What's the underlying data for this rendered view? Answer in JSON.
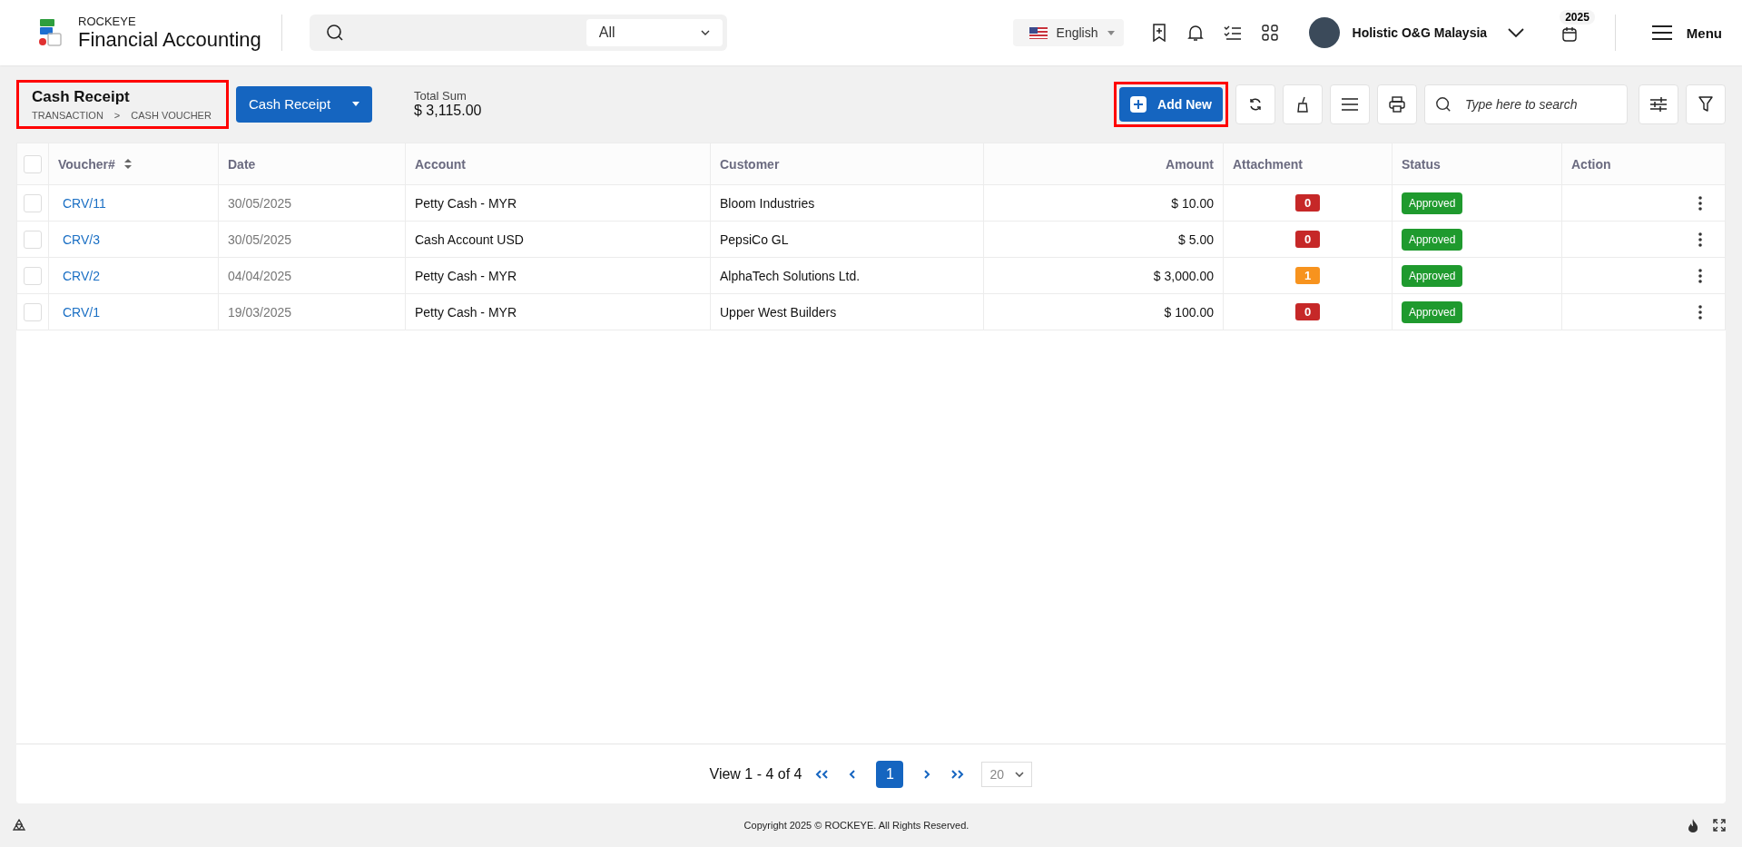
{
  "app": {
    "brand": "ROCKEYE",
    "title": "Financial Accounting"
  },
  "search": {
    "scope": "All"
  },
  "language": "English",
  "user": {
    "name": "Holistic O&G Malaysia"
  },
  "year": "2025",
  "menu": "Menu",
  "page": {
    "title": "Cash Receipt",
    "breadcrumb": [
      "TRANSACTION",
      ">",
      "CASH VOUCHER"
    ],
    "highlighted": true
  },
  "type_dropdown": "Cash Receipt",
  "total": {
    "label": "Total Sum",
    "value": "$ 3,115.00"
  },
  "add_button": {
    "label": "Add New",
    "highlighted": true
  },
  "table_search": {
    "placeholder": "Type here to search"
  },
  "table": {
    "all_checked": false,
    "columns": [
      "Voucher#",
      "Date",
      "Account",
      "Customer",
      "Amount",
      "Attachment",
      "Status",
      "Action"
    ],
    "rows": [
      {
        "checked": false,
        "voucher": "CRV/11",
        "date": "30/05/2025",
        "account": "Petty Cash - MYR",
        "customer": "Bloom Industries",
        "amount": "$ 10.00",
        "attachment": {
          "count": "0",
          "color": "#c62828"
        },
        "status": "Approved"
      },
      {
        "checked": false,
        "voucher": "CRV/3",
        "date": "30/05/2025",
        "account": "Cash Account USD",
        "customer": "PepsiCo GL",
        "amount": "$ 5.00",
        "attachment": {
          "count": "0",
          "color": "#c62828"
        },
        "status": "Approved"
      },
      {
        "checked": false,
        "voucher": "CRV/2",
        "date": "04/04/2025",
        "account": "Petty Cash - MYR",
        "customer": "AlphaTech Solutions Ltd.",
        "amount": "$ 3,000.00",
        "attachment": {
          "count": "1",
          "color": "#f7931e"
        },
        "status": "Approved"
      },
      {
        "checked": false,
        "voucher": "CRV/1",
        "date": "19/03/2025",
        "account": "Petty Cash - MYR",
        "customer": "Upper West Builders",
        "amount": "$ 100.00",
        "attachment": {
          "count": "0",
          "color": "#c62828"
        },
        "status": "Approved"
      }
    ]
  },
  "pagination": {
    "summary": "View 1 - 4 of 4",
    "pages": [
      {
        "label": "1",
        "selected": true
      }
    ],
    "page_size": "20"
  },
  "footer": "Copyright 2025 © ROCKEYE. All Rights Reserved."
}
